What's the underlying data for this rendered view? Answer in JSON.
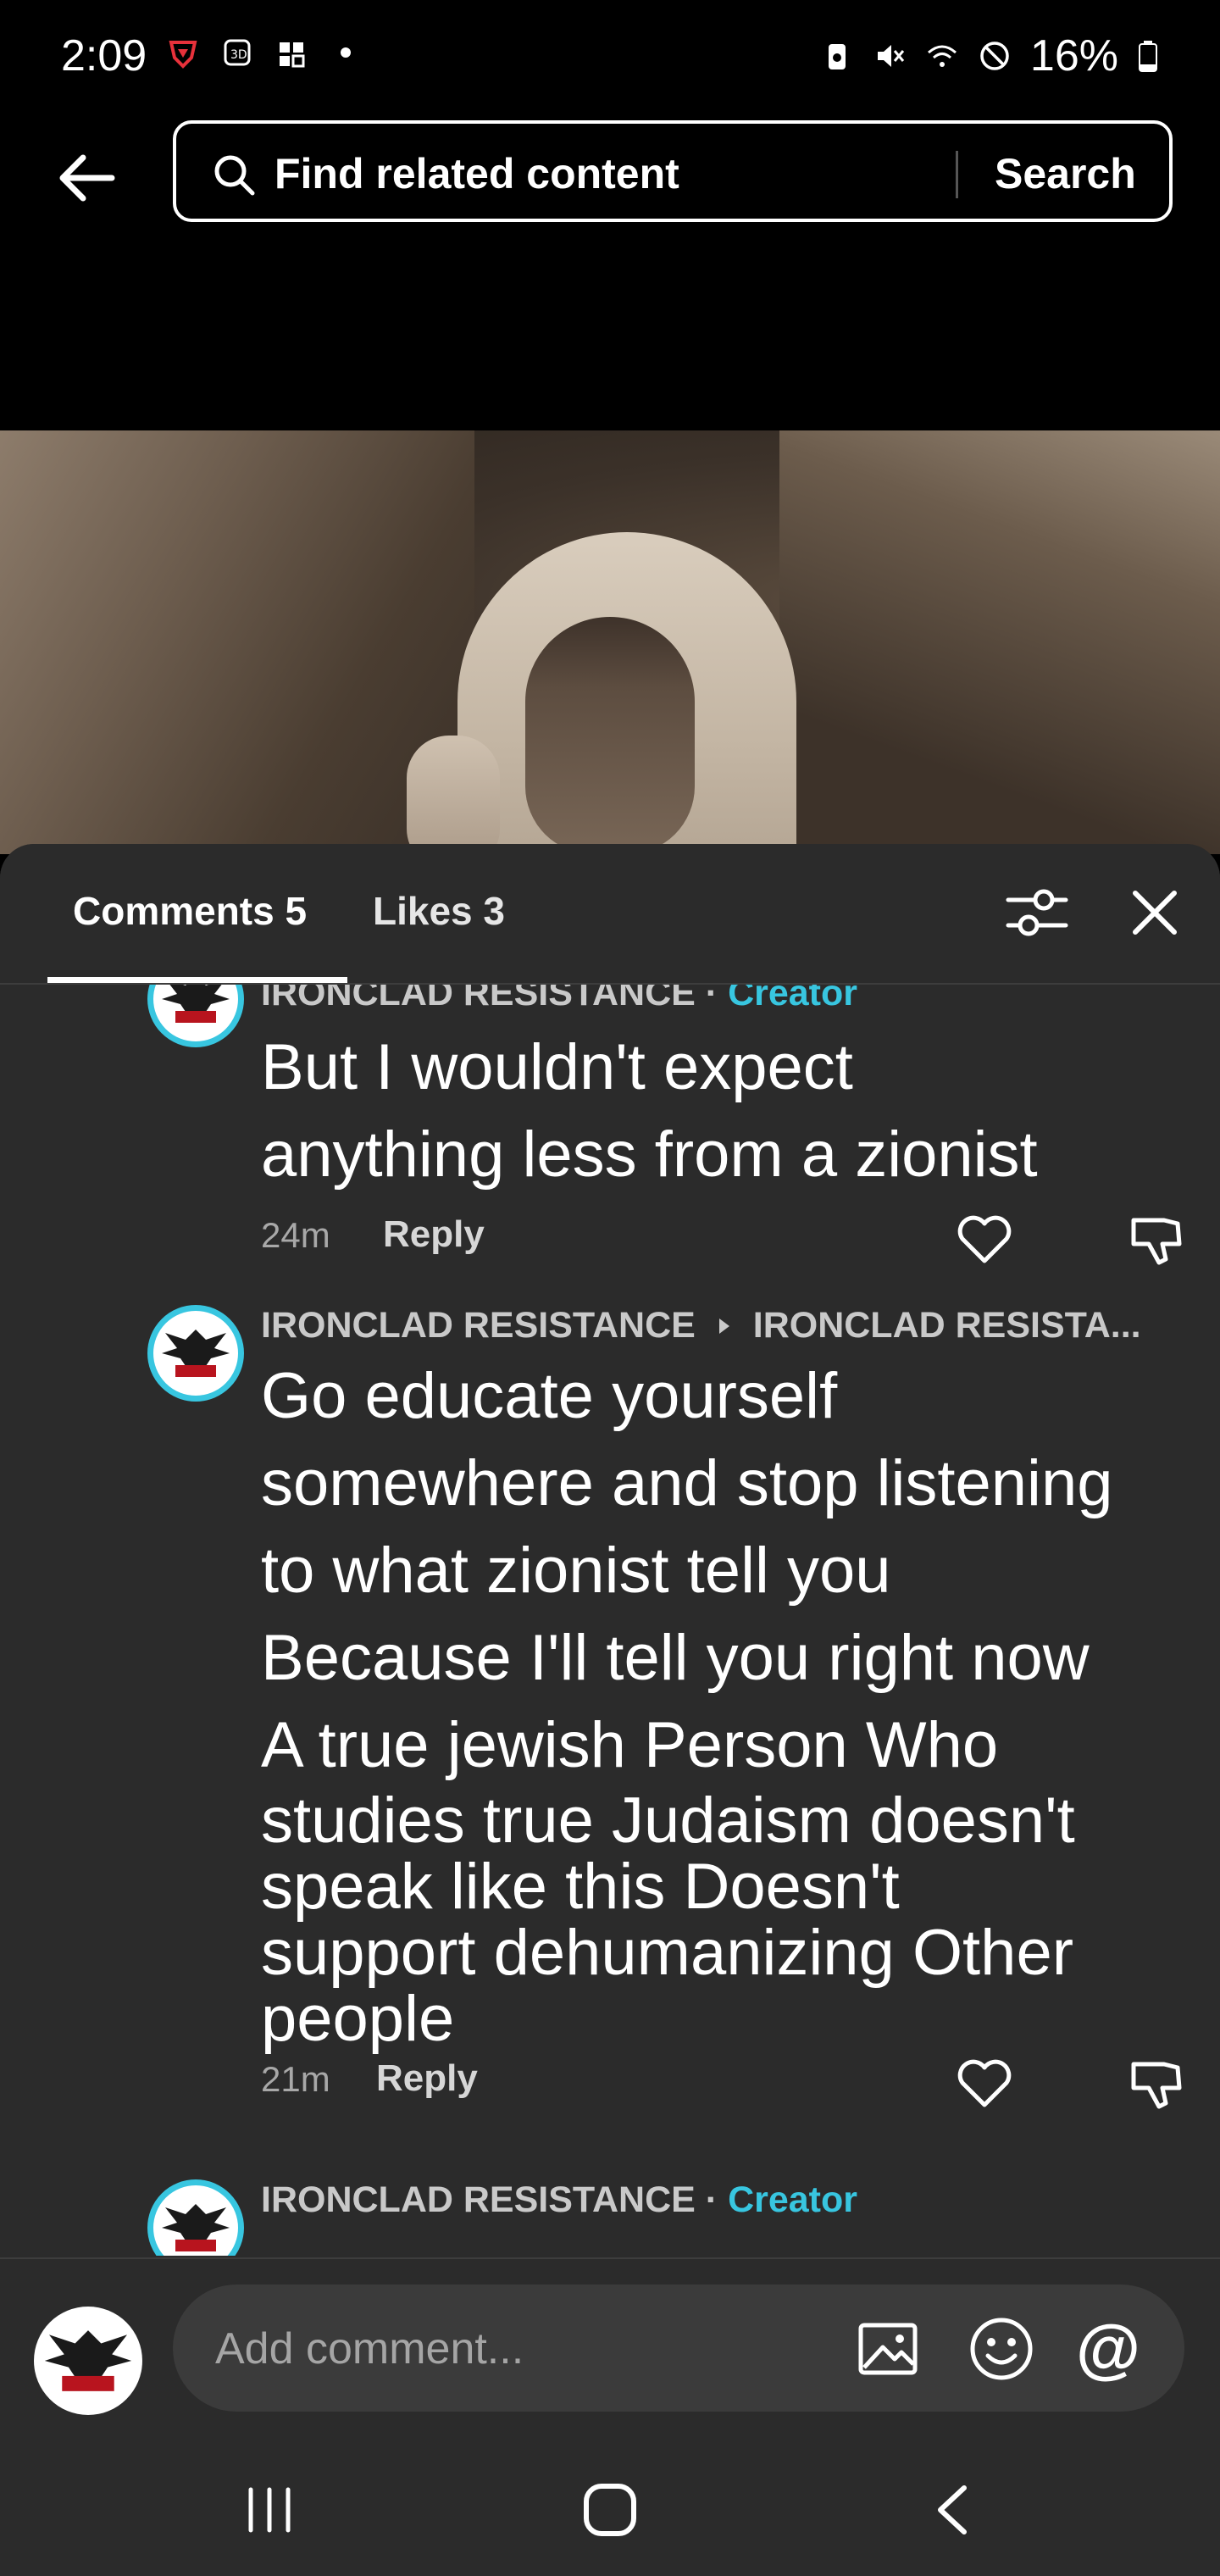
{
  "status_bar": {
    "time": "2:09",
    "battery": "16%"
  },
  "search": {
    "placeholder": "Find related content",
    "button_label": "Search"
  },
  "sheet": {
    "tabs": [
      {
        "label": "Comments 5",
        "active": true
      },
      {
        "label": "Likes 3",
        "active": false
      }
    ]
  },
  "comments": [
    {
      "author": "IRONCLAD RESISTANCE",
      "separator": " · ",
      "badge": "Creator",
      "text_lines": [
        "But I wouldn't expect",
        "anything less from a zionist"
      ],
      "time": "24m",
      "reply_label": "Reply"
    },
    {
      "author": "IRONCLAD RESISTANCE",
      "reply_to": "IRONCLAD RESISTA...",
      "text_lines": [
        "Go educate yourself",
        "somewhere and stop listening",
        "to what zionist tell you",
        "Because I'll tell you right now",
        "A true jewish Person Who"
      ],
      "text_lines_dense": [
        "studies true Judaism doesn't",
        "speak like this Doesn't",
        "support dehumanizing Other",
        "people"
      ],
      "time": "21m",
      "reply_label": "Reply"
    },
    {
      "author": "IRONCLAD RESISTANCE",
      "separator": " · ",
      "badge": "Creator"
    }
  ],
  "input": {
    "placeholder": "Add comment...",
    "at_symbol": "@"
  },
  "colors": {
    "sheet_bg": "#2b2b2b",
    "creator_badge": "#38c6e0",
    "avatar_ring": "#38c6e0"
  }
}
